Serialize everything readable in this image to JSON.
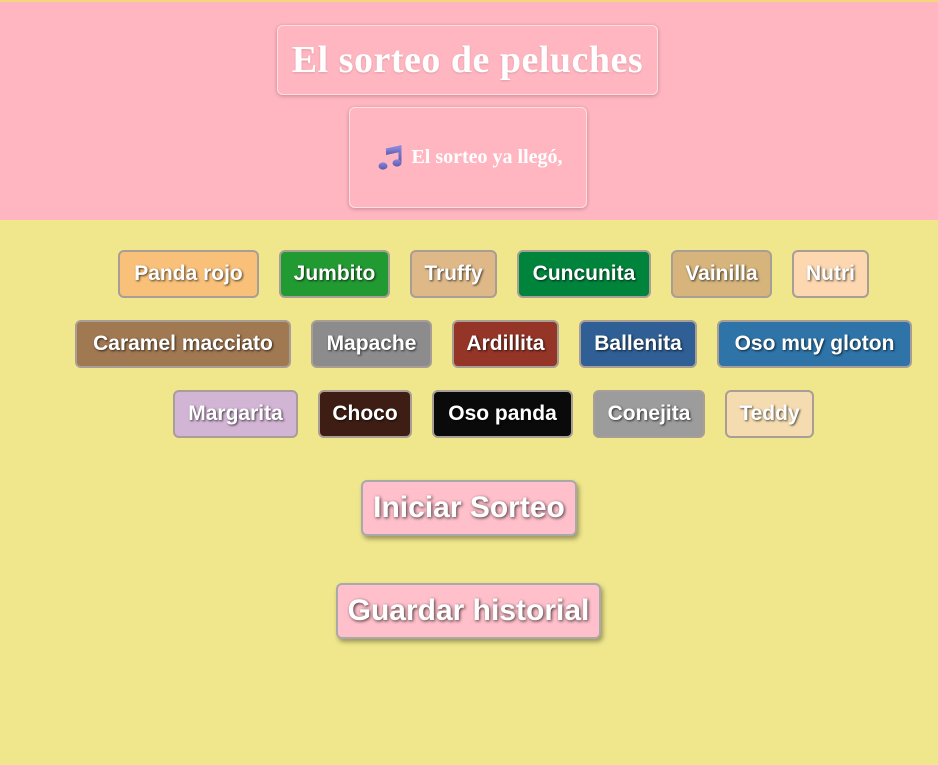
{
  "header": {
    "title": "El sorteo de peluches",
    "song_icon": "music-notes-icon",
    "song_line": "El sorteo ya llegó,"
  },
  "plushies": [
    {
      "label": "Panda rojo",
      "color": "#f8c078"
    },
    {
      "label": "Jumbito",
      "color": "#229a32"
    },
    {
      "label": "Truffy",
      "color": "#dfb888"
    },
    {
      "label": "Cuncunita",
      "color": "#00843c"
    },
    {
      "label": "Vainilla",
      "color": "#d6b47c"
    },
    {
      "label": "Nutri",
      "color": "#fcd7b0"
    },
    {
      "label": "Caramel macciato",
      "color": "#a07852"
    },
    {
      "label": "Mapache",
      "color": "#8c8c8c"
    },
    {
      "label": "Ardillita",
      "color": "#943527"
    },
    {
      "label": "Ballenita",
      "color": "#2f5f94"
    },
    {
      "label": "Oso muy gloton",
      "color": "#2e74a8"
    },
    {
      "label": "Margarita",
      "color": "#d2b4d4"
    },
    {
      "label": "Choco",
      "color": "#3e1e14"
    },
    {
      "label": "Oso panda",
      "color": "#0a0a0a"
    },
    {
      "label": "Conejita",
      "color": "#9c9c9c"
    },
    {
      "label": "Teddy",
      "color": "#f5dcb0"
    }
  ],
  "actions": {
    "start_label": "Iniciar Sorteo",
    "save_label": "Guardar historial"
  },
  "colors": {
    "header_bg": "#ffb6c1",
    "page_bg": "#f0e68c",
    "button_bg": "#ffc0cb"
  }
}
